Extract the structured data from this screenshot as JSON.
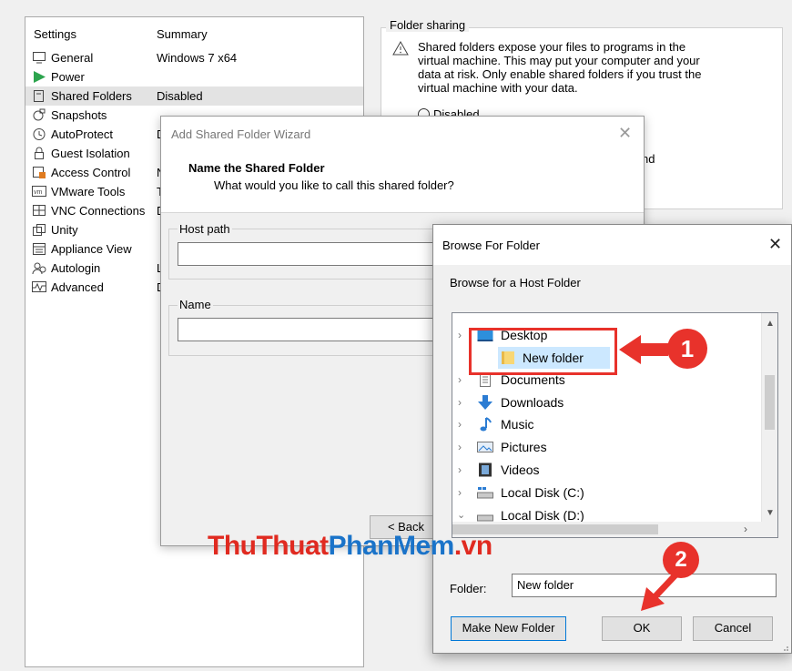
{
  "settings": {
    "col_settings": "Settings",
    "col_summary": "Summary",
    "items": [
      {
        "label": "General",
        "value": "Windows 7 x64"
      },
      {
        "label": "Power",
        "value": ""
      },
      {
        "label": "Shared Folders",
        "value": "Disabled"
      },
      {
        "label": "Snapshots",
        "value": ""
      },
      {
        "label": "AutoProtect",
        "value": "D"
      },
      {
        "label": "Guest Isolation",
        "value": ""
      },
      {
        "label": "Access Control",
        "value": "N"
      },
      {
        "label": "VMware Tools",
        "value": "T"
      },
      {
        "label": "VNC Connections",
        "value": "D"
      },
      {
        "label": "Unity",
        "value": ""
      },
      {
        "label": "Appliance View",
        "value": ""
      },
      {
        "label": "Autologin",
        "value": "L"
      },
      {
        "label": "Advanced",
        "value": "D"
      }
    ],
    "icons": [
      "monitor-icon",
      "play-icon",
      "shared-folder-icon",
      "snapshot-icon",
      "clock-icon",
      "lock-icon",
      "access-control-icon",
      "vm-icon",
      "vnc-icon",
      "unity-icon",
      "appliance-view-icon",
      "autologin-icon",
      "advanced-icon"
    ]
  },
  "folder_sharing": {
    "title": "Folder sharing",
    "warning": "Shared folders expose your files to programs in the virtual machine. This may put your computer and your data at risk. Only enable shared folders if you trust the virtual machine with your data.",
    "option_disabled": "Disabled",
    "partial_text": "nd"
  },
  "wizard": {
    "title": "Add Shared Folder Wizard",
    "heading": "Name the Shared Folder",
    "subheading": "What would you like to call this shared folder?",
    "host_path_label": "Host path",
    "host_path_value": "",
    "name_label": "Name",
    "name_value": "",
    "back_button": "< Back"
  },
  "browse": {
    "title": "Browse For Folder",
    "prompt": "Browse for a Host Folder",
    "tree": [
      {
        "label": "Desktop",
        "icon": "desktop-icon",
        "chevron": "expanded-right",
        "level": 0
      },
      {
        "label": "New folder",
        "icon": "folder-icon",
        "chevron": "",
        "level": 1,
        "selected": true
      },
      {
        "label": "Documents",
        "icon": "documents-icon",
        "chevron": "right",
        "level": 0
      },
      {
        "label": "Downloads",
        "icon": "downloads-icon",
        "chevron": "right",
        "level": 0
      },
      {
        "label": "Music",
        "icon": "music-icon",
        "chevron": "right",
        "level": 0
      },
      {
        "label": "Pictures",
        "icon": "pictures-icon",
        "chevron": "right",
        "level": 0
      },
      {
        "label": "Videos",
        "icon": "videos-icon",
        "chevron": "right",
        "level": 0
      },
      {
        "label": "Local Disk (C:)",
        "icon": "drive-c-icon",
        "chevron": "right",
        "level": 0
      },
      {
        "label": "Local Disk (D:)",
        "icon": "drive-d-icon",
        "chevron": "down",
        "level": 0
      }
    ],
    "folder_label": "Folder:",
    "folder_value": "New folder",
    "make_new_folder": "Make New Folder",
    "ok": "OK",
    "cancel": "Cancel"
  },
  "annotations": {
    "step1": "1",
    "step2": "2",
    "arrow_color": "#e8322b",
    "highlight_color": "#e8322b"
  },
  "watermark": {
    "part1": "ThuThuat",
    "part2": "PhanMem",
    "part3": ".vn",
    "color_red": "#e02a20",
    "color_blue": "#1a73c9"
  },
  "colors": {
    "selection": "#cce8ff",
    "window_bg": "#f0f0f0"
  }
}
